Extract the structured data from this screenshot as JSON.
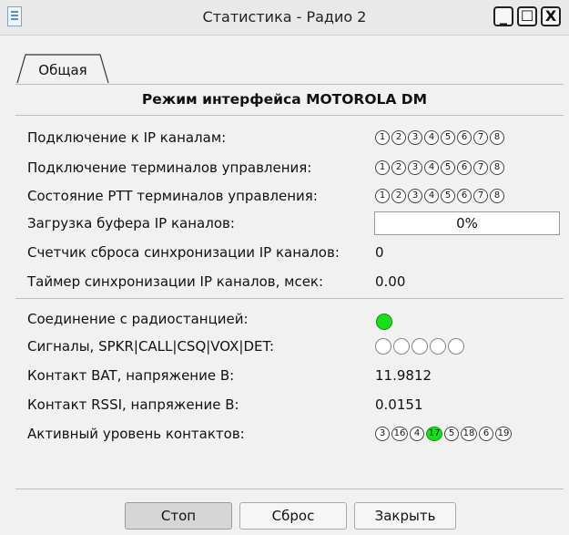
{
  "window": {
    "title": "Статистика - Радио 2",
    "minimize_label": "_",
    "maximize_label": "☐",
    "close_label": "X"
  },
  "tab": {
    "label": "Общая"
  },
  "section": {
    "title": "Режим интерфейса MOTOROLA DM"
  },
  "rows": {
    "ip_channels": {
      "label": "Подключение к IP каналам:"
    },
    "control_terminals": {
      "label": "Подключение терминалов управления:"
    },
    "ptt_state": {
      "label": "Состояние PTT терминалов управления:"
    },
    "buffer_load": {
      "label": "Загрузка буфера IP каналов:",
      "value": "0%",
      "fraction": 0
    },
    "sync_reset": {
      "label": "Счетчик сброса синхронизации IP каналов:",
      "value": "0"
    },
    "sync_timer": {
      "label": "Таймер синхронизации IP каналов, мсек:",
      "value": "0.00"
    },
    "radio_connection": {
      "label": "Соединение с радиостанцией:",
      "status": "connected",
      "color": "#18e018"
    },
    "signals": {
      "label": "Сигналы, SPKR|CALL|CSQ|VOX|DET:"
    },
    "bat_contact": {
      "label": "Контакт BAT, напряжение В:",
      "value": "11.9812"
    },
    "rssi_contact": {
      "label": "Контакт RSSI, напряжение В:",
      "value": "0.0151"
    },
    "active_level": {
      "label": "Активный уровень контактов:"
    }
  },
  "channel_numbers": [
    "1",
    "2",
    "3",
    "4",
    "5",
    "6",
    "7",
    "8"
  ],
  "contact_numbers": [
    "3",
    "16",
    "4",
    "17",
    "5",
    "18",
    "6",
    "19"
  ],
  "contact_active": [
    "17"
  ],
  "buttons": {
    "stop": "Стоп",
    "reset": "Сброс",
    "close": "Закрыть"
  }
}
